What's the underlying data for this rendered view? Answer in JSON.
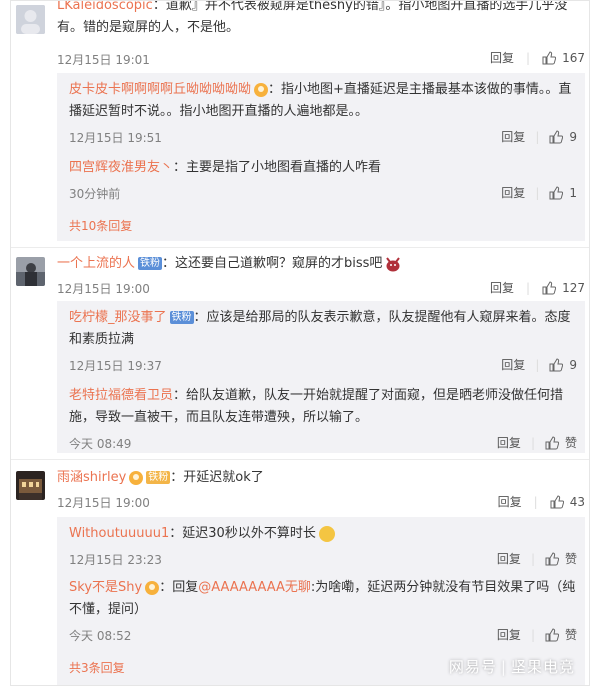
{
  "comments": [
    {
      "user": "LKaleidoscopic",
      "text": "：道歉』并不代表被窥屏是theshy的错』。指小地图开直播的选手几乎没有。错的是窥屏的人，不是他。",
      "time": "12月15日 19:01",
      "reply": "回复",
      "likes": "167",
      "replies": [
        {
          "user": "皮卡皮卡啊啊啊啊丘呦呦呦呦呦",
          "text": "：指小地图+直播延迟是主播最基本该做的事情。。直播延迟暂时不说。。指小地图开直播的人遍地都是。。",
          "time": "12月15日 19:51",
          "reply": "回复",
          "likes": "9"
        },
        {
          "user": "四宫辉夜淮男友丶",
          "text": "：主要是指了小地图看直播的人咋看",
          "time": "30分钟前",
          "reply": "回复",
          "likes": "1"
        }
      ],
      "more": "共10条回复"
    },
    {
      "user": "一个上流的人",
      "badge": "铁粉",
      "text": "：这还要自己道歉啊？窥屏的才biss吧",
      "time": "12月15日 19:00",
      "reply": "回复",
      "likes": "127",
      "replies": [
        {
          "user": "吃柠檬_那没事了",
          "badge": "铁粉",
          "text": "：应该是给那局的队友表示歉意，队友提醒他有人窥屏来着。态度和素质拉满",
          "time": "12月15日 19:37",
          "reply": "回复",
          "likes": "9"
        },
        {
          "user": "老特拉福德看卫员",
          "text": "：给队友道歉，队友一开始就提醒了对面窥，但是晒老师没做任何措施，导致一直被干，而且队友连带遭殃，所以输了。",
          "time": "今天 08:49",
          "reply": "回复",
          "likes": "赞"
        }
      ]
    },
    {
      "user": "雨涵shirley",
      "badge": "铁粉",
      "text": "：开延迟就ok了",
      "time": "12月15日 19:00",
      "reply": "回复",
      "likes": "43",
      "replies": [
        {
          "user": "Withoutuuuuu1",
          "text": "：延迟30秒以外不算时长",
          "time": "12月15日 23:23",
          "reply": "回复",
          "likes": "赞"
        },
        {
          "user": "Sky不是Shy",
          "text": "：回复",
          "mention": "@AAAAAAAA无聊",
          "text2": ":为啥嘞，延迟两分钟就没有节目效果了吗（纯不懂，提问）",
          "time": "今天 08:52",
          "reply": "回复",
          "likes": "赞"
        }
      ],
      "more": "共3条回复"
    }
  ],
  "watermark": {
    "left": "网易号",
    "sep": "|",
    "right": "坚果电竞"
  },
  "colors": {
    "name": "#eb7350",
    "sub_bg": "#f2f2f5",
    "meta": "#808080"
  },
  "icons": [
    "thumb-up-icon",
    "avatar",
    "vip-icon",
    "emoji-icon"
  ]
}
